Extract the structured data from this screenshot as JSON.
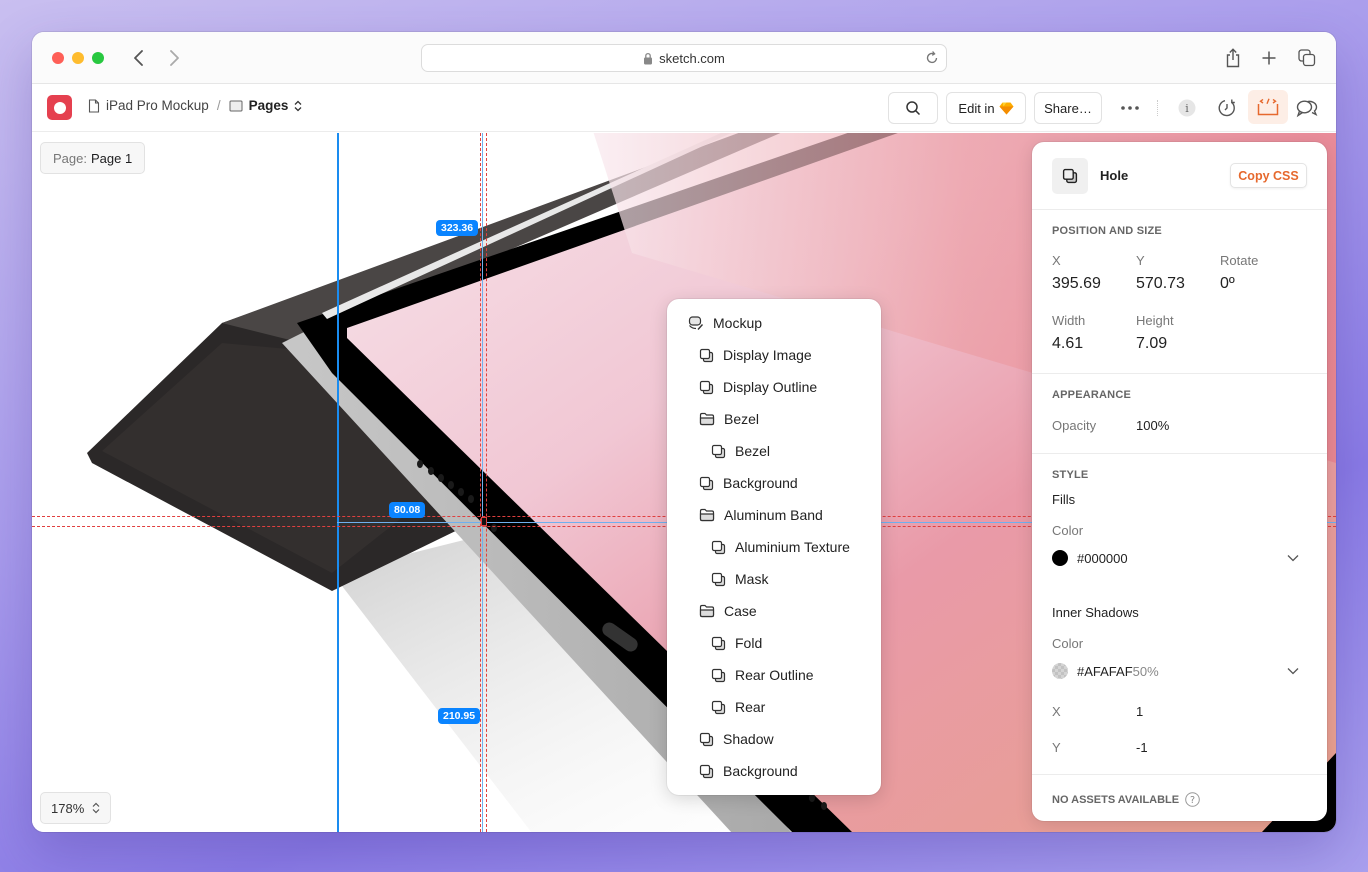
{
  "browser": {
    "url": "sketch.com",
    "icons": [
      "back-icon",
      "forward-icon",
      "lock-icon",
      "reload-icon",
      "share-icon",
      "new-tab-icon",
      "tab-overview-icon"
    ]
  },
  "toolbar": {
    "document_name": "iPad Pro Mockup",
    "separator": "/",
    "pages_label": "Pages",
    "edit_in_label": "Edit in",
    "share_label": "Share…",
    "accent_color": "#e6692e"
  },
  "canvas": {
    "page_label": "Page:",
    "page_value": "Page 1",
    "zoom_level": "178%",
    "measurements": {
      "top": "323.36",
      "left": "80.08",
      "bottom": "210.95"
    }
  },
  "layers": {
    "items": [
      {
        "label": "Mockup",
        "type": "symbol",
        "level": 0
      },
      {
        "label": "Display Image",
        "type": "layer",
        "level": 1
      },
      {
        "label": "Display Outline",
        "type": "layer",
        "level": 1
      },
      {
        "label": "Bezel",
        "type": "group",
        "level": 1
      },
      {
        "label": "Bezel",
        "type": "layer",
        "level": 2
      },
      {
        "label": "Background",
        "type": "layer",
        "level": 1
      },
      {
        "label": "Aluminum Band",
        "type": "group",
        "level": 1
      },
      {
        "label": "Aluminium Texture",
        "type": "layer",
        "level": 2
      },
      {
        "label": "Mask",
        "type": "layer",
        "level": 2
      },
      {
        "label": "Case",
        "type": "group",
        "level": 1
      },
      {
        "label": "Fold",
        "type": "layer",
        "level": 2
      },
      {
        "label": "Rear Outline",
        "type": "layer",
        "level": 2
      },
      {
        "label": "Rear",
        "type": "layer",
        "level": 2
      },
      {
        "label": "Shadow",
        "type": "layer",
        "level": 1
      },
      {
        "label": "Background",
        "type": "layer",
        "level": 1
      }
    ]
  },
  "inspector": {
    "layer_name": "Hole",
    "copy_css_label": "Copy CSS",
    "position_size": {
      "title": "POSITION AND SIZE",
      "x_label": "X",
      "x_value": "395.69",
      "y_label": "Y",
      "y_value": "570.73",
      "rotate_label": "Rotate",
      "rotate_value": "0º",
      "width_label": "Width",
      "width_value": "4.61",
      "height_label": "Height",
      "height_value": "7.09"
    },
    "appearance": {
      "title": "APPEARANCE",
      "opacity_label": "Opacity",
      "opacity_value": "100%"
    },
    "style": {
      "title": "STYLE",
      "fills_label": "Fills",
      "fill_color_label": "Color",
      "fill_color_value": "#000000",
      "inner_shadows_label": "Inner Shadows",
      "shadow_color_label": "Color",
      "shadow_color_value": "#AFAFAF",
      "shadow_opacity": "50%",
      "shadow_x_label": "X",
      "shadow_x_value": "1",
      "shadow_y_label": "Y",
      "shadow_y_value": "-1"
    },
    "assets_label": "NO ASSETS AVAILABLE"
  }
}
